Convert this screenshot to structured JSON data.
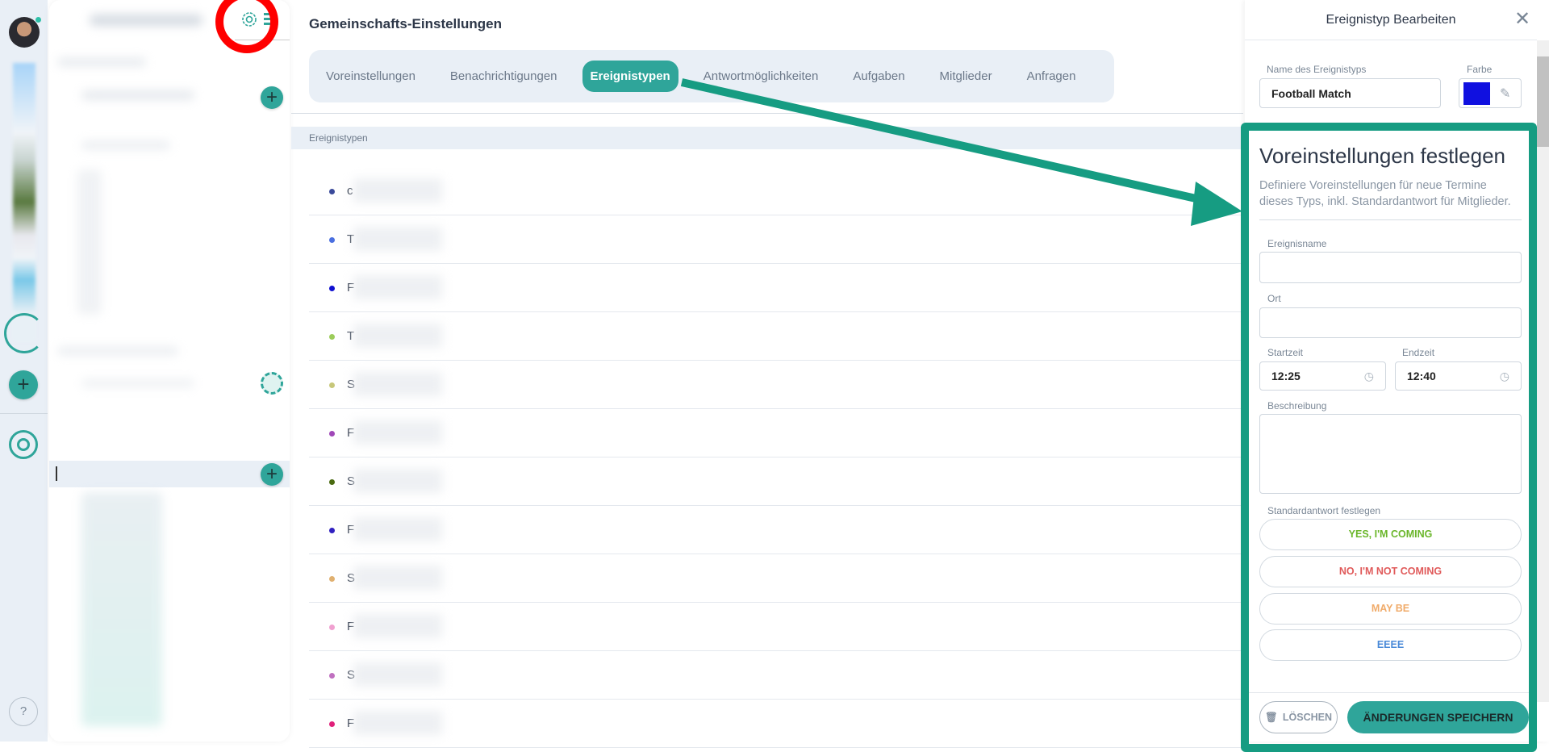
{
  "page": {
    "title": "Gemeinschafts-Einstellungen"
  },
  "tabs": [
    {
      "label": "Voreinstellungen"
    },
    {
      "label": "Benachrichtigungen"
    },
    {
      "label": "Ereignistypen",
      "active": true
    },
    {
      "label": "Antwortmöglichkeiten"
    },
    {
      "label": "Aufgaben"
    },
    {
      "label": "Mitglieder"
    },
    {
      "label": "Anfragen"
    }
  ],
  "list": {
    "header": "Ereignistypen",
    "items": [
      {
        "initial": "c",
        "color": "#3a4a9a"
      },
      {
        "initial": "T",
        "color": "#4a6fe0"
      },
      {
        "initial": "F",
        "color": "#1010d0"
      },
      {
        "initial": "T",
        "color": "#9ccc5a"
      },
      {
        "initial": "S",
        "color": "#c7c77a"
      },
      {
        "initial": "F",
        "color": "#a048b8"
      },
      {
        "initial": "S",
        "color": "#4a6a10"
      },
      {
        "initial": "F",
        "color": "#3020c0"
      },
      {
        "initial": "S",
        "color": "#e0b070"
      },
      {
        "initial": "F",
        "color": "#f0a0d0"
      },
      {
        "initial": "S",
        "color": "#c070c0"
      },
      {
        "initial": "F",
        "color": "#e0207a"
      }
    ]
  },
  "panel": {
    "title": "Ereignistyp Bearbeiten",
    "name_label": "Name des Ereignistyps",
    "name_value": "Football Match",
    "color_label": "Farbe",
    "color_value": "#1010e0",
    "defaults_title": "Voreinstellungen festlegen",
    "defaults_desc": "Definiere Voreinstellungen für neue Termine dieses Typs, inkl. Standardantwort für Mitglieder.",
    "event_name_label": "Ereignisname",
    "event_name_value": "",
    "location_label": "Ort",
    "location_value": "",
    "start_label": "Startzeit",
    "start_value": "12:25",
    "end_label": "Endzeit",
    "end_value": "12:40",
    "description_label": "Beschreibung",
    "description_value": "",
    "default_answer_label": "Standardantwort festlegen",
    "answers": [
      {
        "label": "YES, I'M COMING",
        "color": "#6ab62a"
      },
      {
        "label": "NO, I'M NOT COMING",
        "color": "#e05a5a"
      },
      {
        "label": "MAY BE",
        "color": "#f0ab6a"
      },
      {
        "label": "EEEE",
        "color": "#4a8ad8"
      }
    ],
    "delete_label": "LÖSCHEN",
    "save_label": "ÄNDERUNGEN SPEICHERN"
  },
  "colors": {
    "accent": "#2fa59a",
    "annotation_green": "#169c82",
    "annotation_red": "#ff0000"
  }
}
